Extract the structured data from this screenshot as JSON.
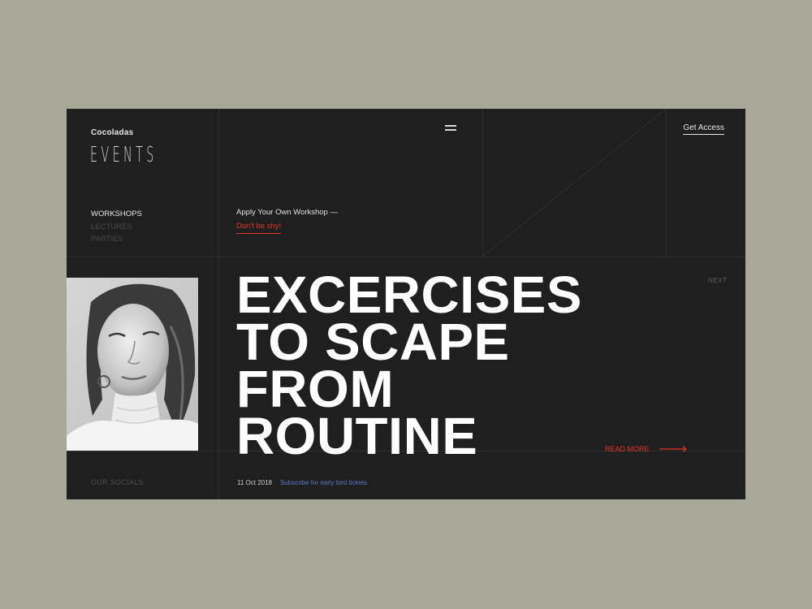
{
  "brand": {
    "small": "Cocoladas",
    "big": "EVENTS"
  },
  "nav": {
    "items": [
      "WORKSHOPS",
      "LECTURES",
      "PARTIES"
    ]
  },
  "apply": {
    "title": "Apply Your Own Workshop —",
    "link": "Don't be shy!"
  },
  "header": {
    "get_access": "Get Access"
  },
  "hero": {
    "lines": [
      "EXCERCISES",
      "TO SCAPE",
      "FROM",
      "ROUTINE"
    ],
    "next": "NEXT",
    "read_more": "READ MORE"
  },
  "footer": {
    "socials": "OUR SOCIALS",
    "date": "11 Oct 2018",
    "subscribe": "Subscribe for early bird tickets"
  },
  "colors": {
    "page_bg": "#a9a797",
    "panel_bg": "#1f1f20",
    "accent": "#e2362a",
    "link_blue": "#5f76c8",
    "text_light": "#e8e8e8"
  },
  "icons": [
    "menu-icon",
    "arrow-right-icon"
  ]
}
